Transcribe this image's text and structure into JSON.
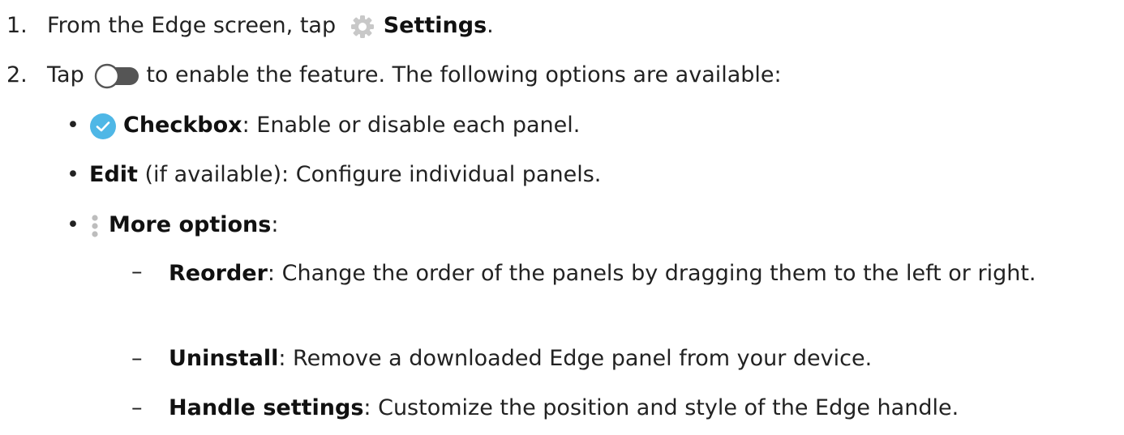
{
  "step1": {
    "number": "1.",
    "text_before": "From the Edge screen, tap",
    "icon": "gear-icon",
    "bold": "Settings",
    "text_after": "."
  },
  "step2": {
    "number": "2.",
    "text_before": "Tap",
    "icon": "toggle-switch-icon",
    "text_after": "to enable the feature. The following options are available:"
  },
  "bullets": [
    {
      "symbol": "•",
      "icon": "checkbox-checked-icon",
      "bold": "Checkbox",
      "text": ": Enable or disable each panel."
    },
    {
      "symbol": "•",
      "bold": "Edit",
      "text": " (if available): Configure individual panels."
    },
    {
      "symbol": "•",
      "icon": "more-options-icon",
      "bold": "More options",
      "text": ":"
    }
  ],
  "sub_items": [
    {
      "symbol": "–",
      "bold": "Reorder",
      "text": ": Change the order of the panels by dragging them to the left or right."
    },
    {
      "symbol": "–",
      "bold": "Uninstall",
      "text": ": Remove a downloaded Edge panel from your device."
    },
    {
      "symbol": "–",
      "bold": "Handle settings",
      "text": ": Customize the position and style of the Edge handle."
    }
  ],
  "colors": {
    "gear": "#c8c8c8",
    "toggle_track": "#555555",
    "checkbox": "#4fb7e6",
    "more_dots": "#bdbdbd"
  }
}
